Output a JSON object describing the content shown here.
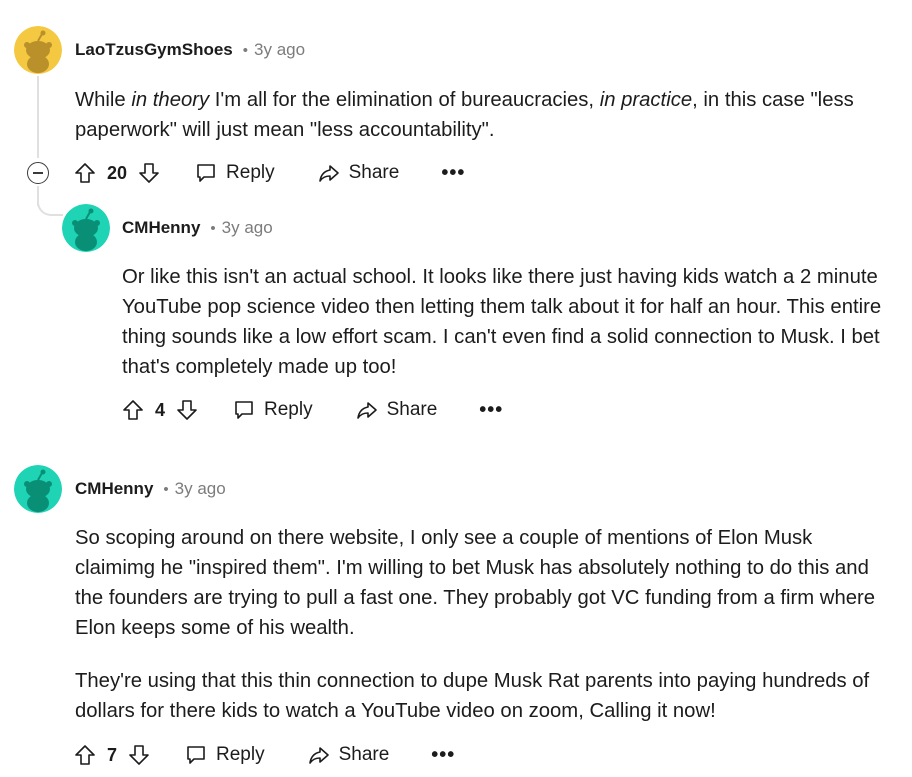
{
  "comments": [
    {
      "author": "LaoTzusGymShoes",
      "dot": "•",
      "time": "3y ago",
      "body_parts": [
        "While ",
        "in theory",
        " I'm all for the elimination of bureaucracies, ",
        "in practice",
        ", in this case \"less paperwork\" will just mean \"less accountability\"."
      ],
      "score": "20",
      "reply_label": "Reply",
      "share_label": "Share",
      "more_label": "•••",
      "avatar_color": "#f5c842"
    },
    {
      "author": "CMHenny",
      "dot": "•",
      "time": "3y ago",
      "paragraphs": [
        "Or like this isn't an actual school. It looks like there just having kids watch a 2 minute YouTube pop science video then letting them talk about it for half an hour. This entire thing sounds like a low effort scam. I can't even find a solid connection to Musk. I bet that's completely made up too!"
      ],
      "score": "4",
      "reply_label": "Reply",
      "share_label": "Share",
      "more_label": "•••",
      "avatar_color": "#1ed4b4"
    },
    {
      "author": "CMHenny",
      "dot": "•",
      "time": "3y ago",
      "paragraphs": [
        "So scoping around on there website, I only see a couple of mentions of Elon Musk claimimg he \"inspired them\". I'm willing to bet Musk has absolutely nothing to do this and the founders are trying to pull a fast one. They probably got VC funding from a firm where Elon keeps some of his wealth.",
        "They're using that this thin connection to dupe Musk Rat parents into paying hundreds of dollars for there kids to watch a YouTube video on zoom, Calling it now!"
      ],
      "score": "7",
      "reply_label": "Reply",
      "share_label": "Share",
      "more_label": "•••",
      "avatar_color": "#1ed4b4"
    }
  ],
  "icons": {
    "upvote": "upvote-icon",
    "downvote": "downvote-icon",
    "reply": "reply-icon",
    "share": "share-icon",
    "collapse": "collapse-icon"
  }
}
